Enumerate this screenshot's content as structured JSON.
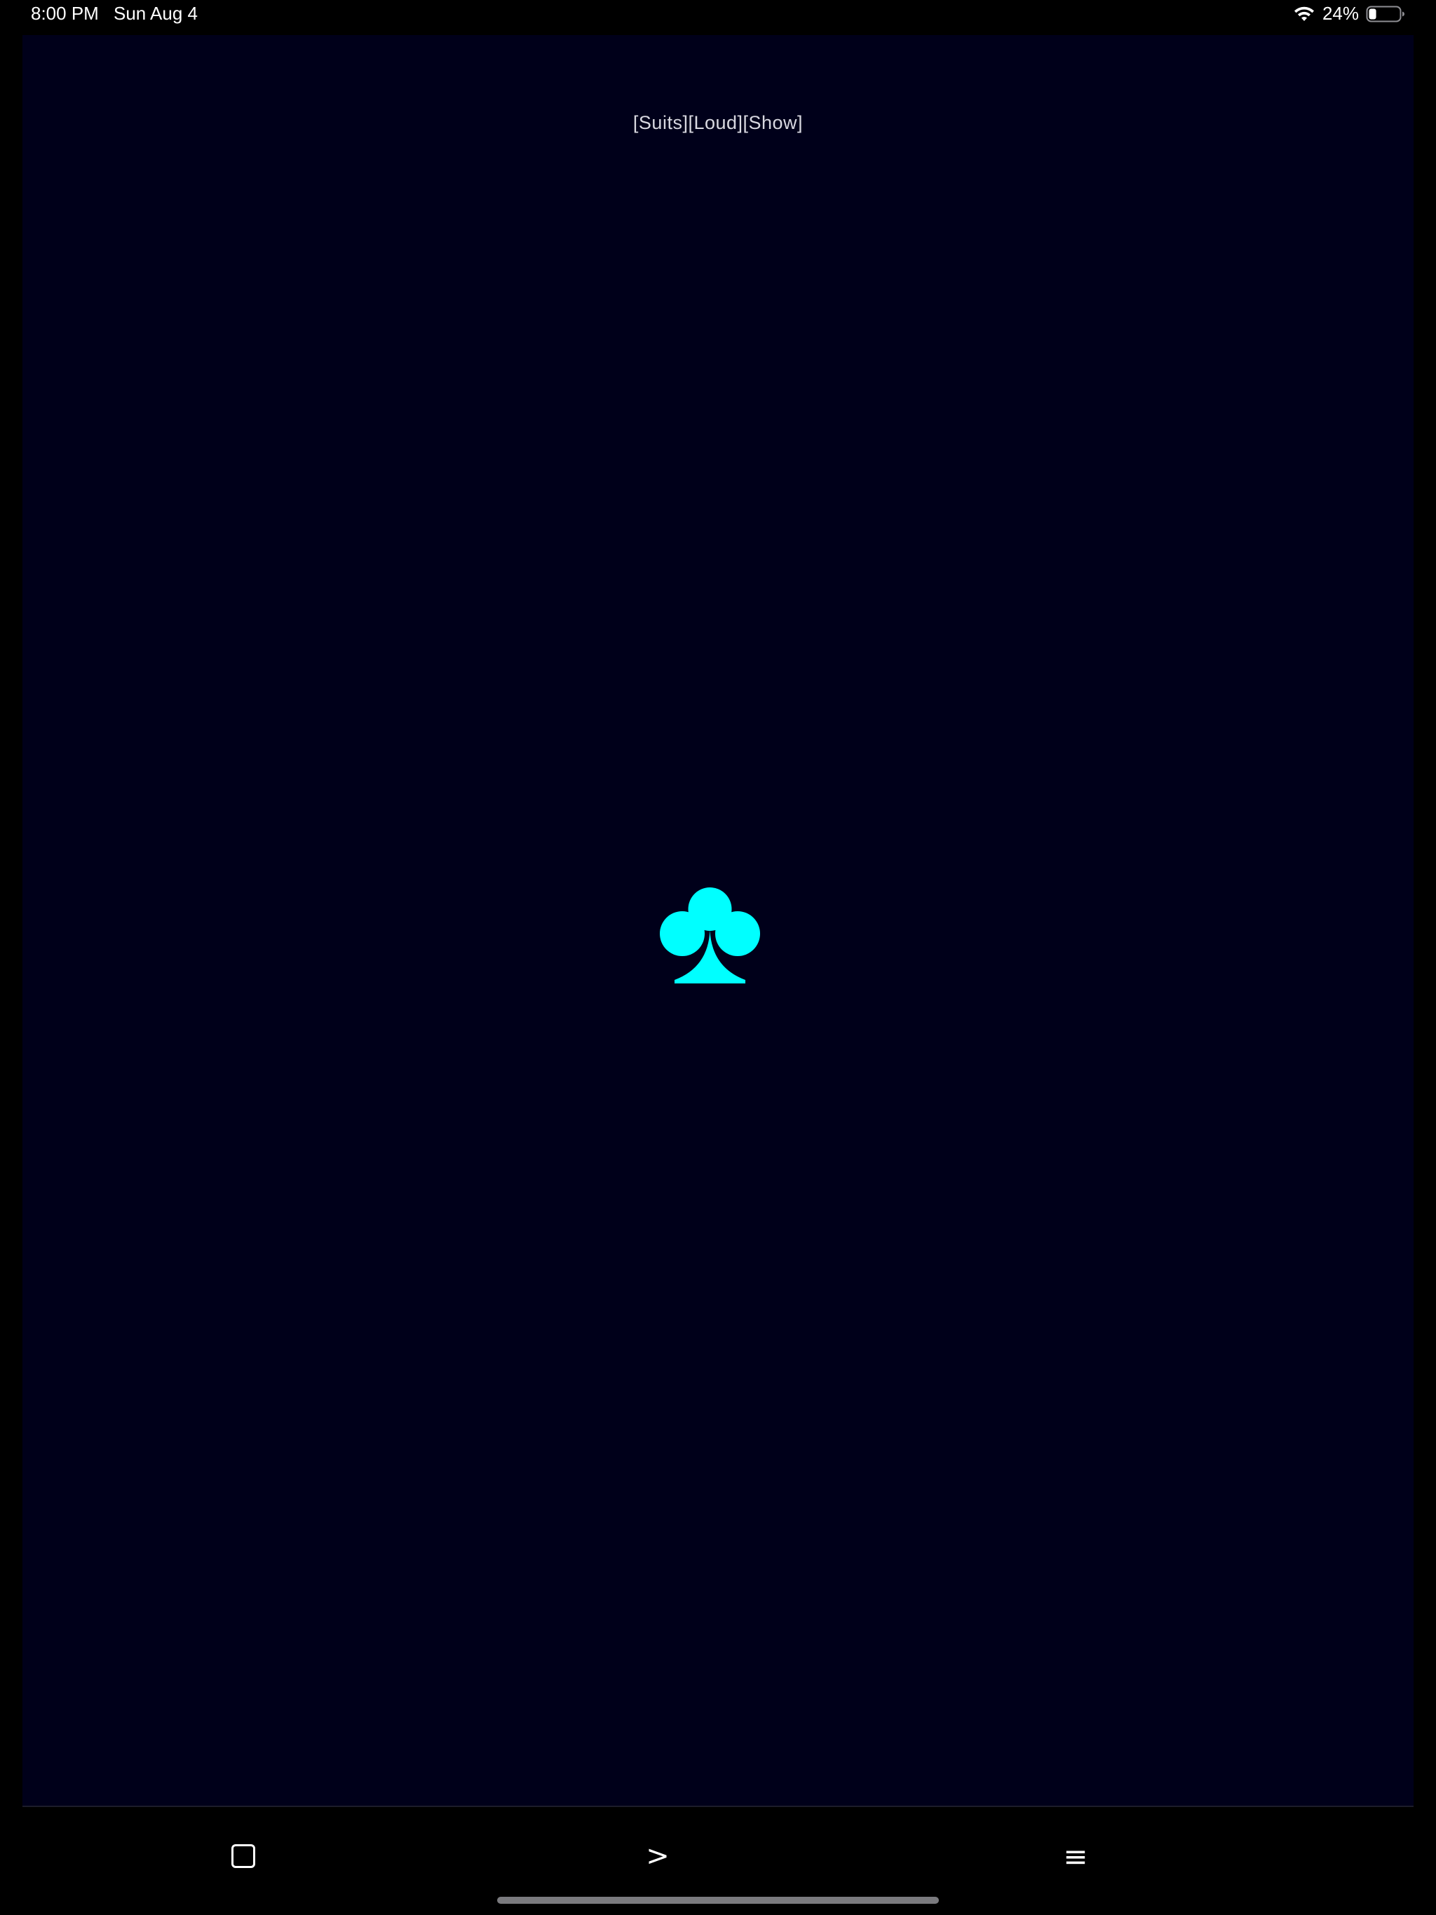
{
  "status_bar": {
    "time": "8:00 PM",
    "date": "Sun Aug 4",
    "battery_percent": "24%",
    "battery_level": 0.24,
    "wifi_icon": "wifi-icon",
    "battery_icon": "battery-icon"
  },
  "main": {
    "mode_label": "[Suits][Loud][Show]",
    "current_suit": "club",
    "suit_icon": "club-icon",
    "suit_color": "#00ffff",
    "background_color": "#00001a"
  },
  "toolbar": {
    "square_icon": "square-icon",
    "next_label": ">",
    "menu_label": "≡"
  }
}
